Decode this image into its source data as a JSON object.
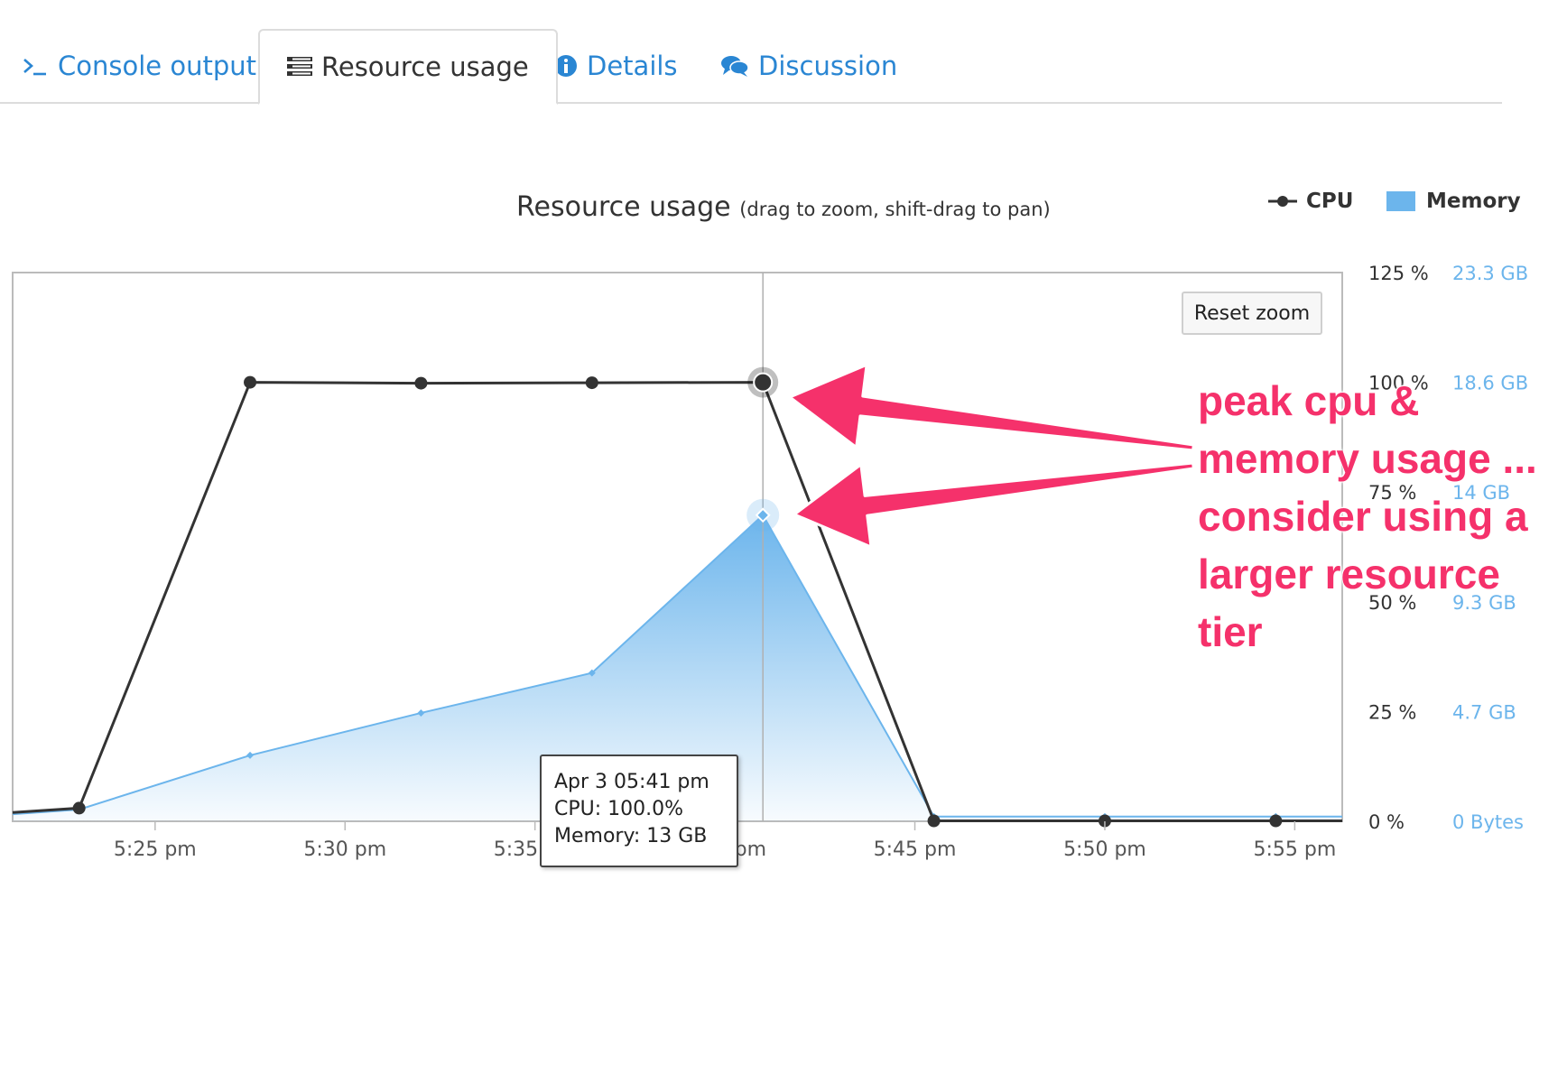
{
  "tabs": [
    {
      "label": "Console output",
      "icon": "terminal-icon",
      "active": false
    },
    {
      "label": "Resource usage",
      "icon": "list-icon",
      "active": true
    },
    {
      "label": "Details",
      "icon": "info-icon",
      "active": false
    },
    {
      "label": "Discussion",
      "icon": "comments-icon",
      "active": false
    }
  ],
  "chart_header": {
    "title": "Resource usage",
    "subtitle": "(drag to zoom, shift-drag to pan)"
  },
  "reset_zoom_label": "Reset zoom",
  "tooltip": {
    "line1": "Apr 3 05:41 pm",
    "line2": "CPU: 100.0%",
    "line3": "Memory: 13 GB"
  },
  "annotation_text": "peak cpu & memory usage ... consider using a larger resource tier",
  "colors": {
    "cpu": "#333333",
    "memory": "#6cb5ec",
    "tab_link": "#2a86d3",
    "annotation": "#f5316b"
  },
  "chart_data": {
    "type": "line",
    "title": "Resource usage",
    "x_ticks": [
      "5:25 pm",
      "5:30 pm",
      "5:35 pm",
      "5:40 pm",
      "5:45 pm",
      "5:50 pm",
      "5:55 pm"
    ],
    "xlim_minutes_past_5pm": [
      21.25,
      56.25
    ],
    "y_left_ticks": [
      "125 %",
      "100 %",
      "75 %",
      "50 %",
      "25 %",
      "0 %"
    ],
    "y_right_ticks": [
      "23.3 GB",
      "18.6 GB",
      "14 GB",
      "9.3 GB",
      "4.7 GB",
      "0 Bytes"
    ],
    "y_left_range": [
      0,
      125
    ],
    "y_right_range_gb": [
      0,
      23.3
    ],
    "series": [
      {
        "name": "CPU",
        "type": "line",
        "unit": "%",
        "points": [
          {
            "x": 21.25,
            "y": 2.0
          },
          {
            "x": 23.0,
            "y": 3.0
          },
          {
            "x": 27.5,
            "y": 100.0
          },
          {
            "x": 32.0,
            "y": 99.8
          },
          {
            "x": 36.5,
            "y": 99.9
          },
          {
            "x": 41.0,
            "y": 100.0
          },
          {
            "x": 45.5,
            "y": 0.1
          },
          {
            "x": 50.0,
            "y": 0.1
          },
          {
            "x": 54.5,
            "y": 0.1
          },
          {
            "x": 56.25,
            "y": 0.1
          }
        ]
      },
      {
        "name": "Memory",
        "type": "area",
        "unit": "GB",
        "points": [
          {
            "x": 21.25,
            "y": 0.3
          },
          {
            "x": 23.0,
            "y": 0.5
          },
          {
            "x": 27.5,
            "y": 2.8
          },
          {
            "x": 32.0,
            "y": 4.6
          },
          {
            "x": 36.5,
            "y": 6.3
          },
          {
            "x": 41.0,
            "y": 13.0
          },
          {
            "x": 45.5,
            "y": 0.2
          },
          {
            "x": 50.0,
            "y": 0.2
          },
          {
            "x": 54.5,
            "y": 0.2
          },
          {
            "x": 56.25,
            "y": 0.2
          }
        ]
      }
    ],
    "highlight_x": 41.0,
    "grid": false,
    "legend_position": "top-right"
  }
}
